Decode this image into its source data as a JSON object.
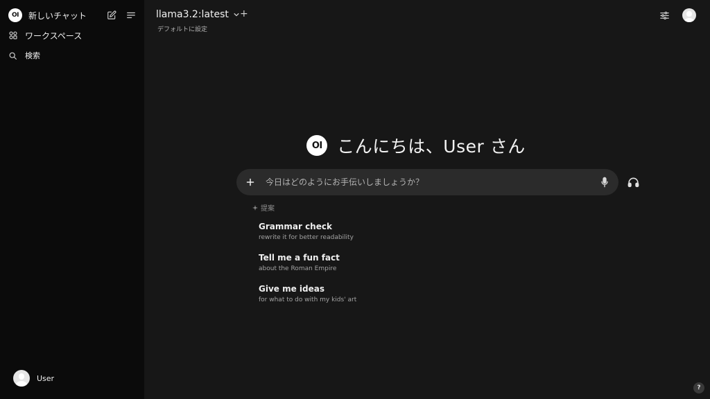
{
  "sidebar": {
    "logo_text": "OI",
    "new_chat_label": "新しいチャット",
    "workspace_label": "ワークスペース",
    "search_label": "検索",
    "user_name": "User"
  },
  "topbar": {
    "model_name": "llama3.2:latest",
    "add_model": "+",
    "set_default_label": "デフォルトに設定"
  },
  "main": {
    "logo_text": "OI",
    "greeting": "こんにちは、User さん",
    "input_placeholder": "今日はどのようにお手伝いしましょうか？",
    "suggestions_heading": "提案",
    "suggestions": [
      {
        "title": "Grammar check",
        "subtitle": "rewrite it for better readability"
      },
      {
        "title": "Tell me a fun fact",
        "subtitle": "about the Roman Empire"
      },
      {
        "title": "Give me ideas",
        "subtitle": "for what to do with my kids' art"
      }
    ],
    "help_label": "?"
  },
  "icons": {
    "new_chat": "pencil-square-icon",
    "sidebar_toggle": "menu-lines-icon",
    "workspace": "grid-shapes-icon",
    "search": "search-icon",
    "model_dropdown": "chevron-down-icon",
    "controls": "sliders-icon",
    "attach": "plus-icon",
    "mic": "microphone-icon",
    "voice_mode": "headphones-icon",
    "suggestion": "sparkle-icon"
  },
  "colors": {
    "sidebar_bg": "#0b0b0b",
    "main_bg": "#171717",
    "input_bg": "#2b2b2b"
  }
}
